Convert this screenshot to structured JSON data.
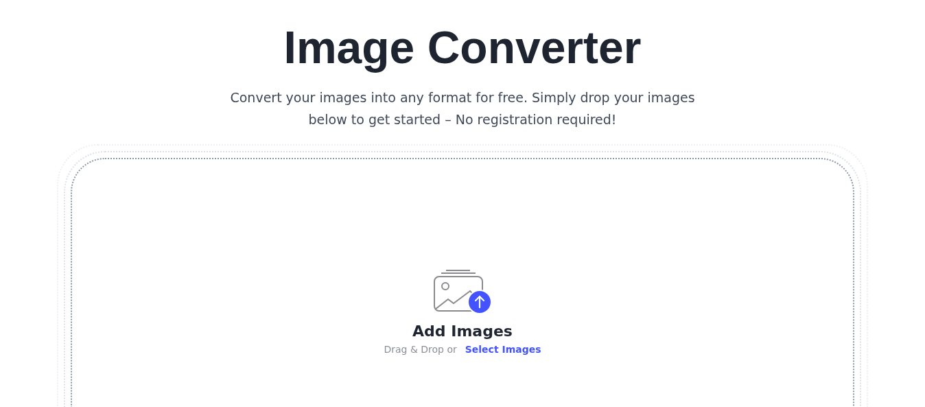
{
  "title": "Image Converter",
  "subtitle": "Convert your images into any format for free. Simply drop your images below to get started – No registration required!",
  "dropzone": {
    "heading": "Add Images",
    "hint": "Drag & Drop or",
    "link": "Select Images"
  }
}
